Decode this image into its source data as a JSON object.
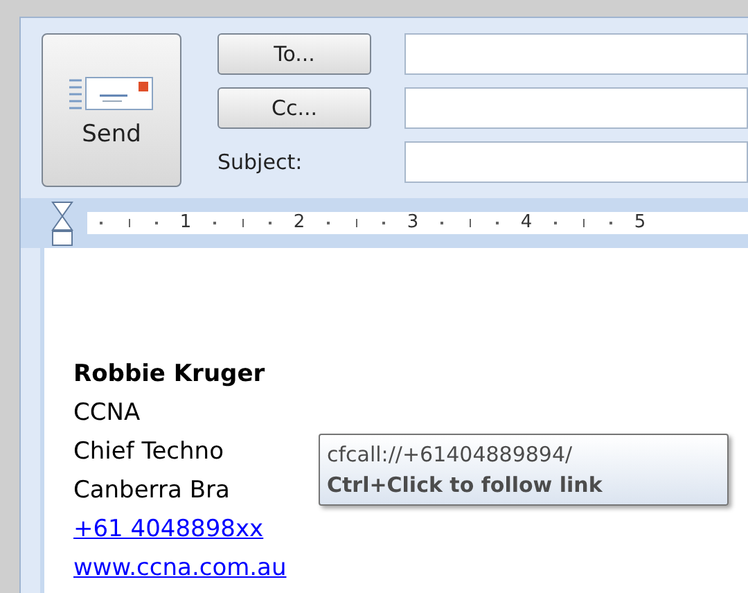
{
  "send_button": {
    "label": "Send"
  },
  "address_buttons": [
    "To...",
    "Cc..."
  ],
  "subject": {
    "label": "Subject:"
  },
  "ruler": {
    "labels": [
      "1",
      "2",
      "3",
      "4",
      "5"
    ]
  },
  "body": [
    {
      "kind": "name",
      "text": "Robbie Kruger"
    },
    {
      "kind": "text",
      "text": "CCNA"
    },
    {
      "kind": "text",
      "text": "Chief Techno"
    },
    {
      "kind": "text",
      "text": "Canberra Bra"
    },
    {
      "kind": "link",
      "text": "+61 4048898xx"
    },
    {
      "kind": "link",
      "text": "www.ccna.com.au"
    }
  ],
  "tooltip": {
    "lines": [
      "cfcall://+61404889894/",
      "Ctrl+Click to follow link"
    ]
  }
}
